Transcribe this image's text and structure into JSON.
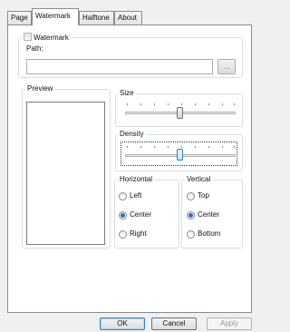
{
  "tabs": [
    "Page",
    "Watermark",
    "Halftone",
    "About"
  ],
  "watermark": {
    "checkbox_label": "Watermark",
    "checked": false,
    "path_label": "Path:",
    "path_value": "",
    "browse_label": "..."
  },
  "preview": {
    "label": "Preview"
  },
  "size": {
    "label": "Size",
    "value_fraction": 0.5
  },
  "density": {
    "label": "Density",
    "value_fraction": 0.5
  },
  "horizontal": {
    "label": "Horizontal",
    "options": [
      "Left",
      "Center",
      "Right"
    ],
    "selected": "Center"
  },
  "vertical": {
    "label": "Vertical",
    "options": [
      "Top",
      "Center",
      "Bottom"
    ],
    "selected": "Center"
  },
  "buttons": {
    "ok": "OK",
    "cancel": "Cancel",
    "apply": "Apply"
  },
  "colors": {
    "accent": "#3c7fb1",
    "radio_dot": "#2e6fc0",
    "group_border": "#d5dfe5"
  }
}
